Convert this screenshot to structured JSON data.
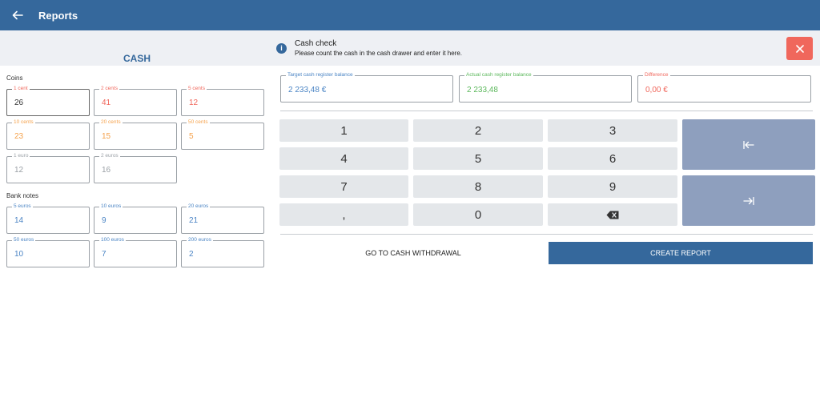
{
  "app_bar": {
    "title": "Reports",
    "back_icon": "arrow-left-icon",
    "color": "#35689c"
  },
  "cash_panel": {
    "heading": "CASH",
    "coins_label": "Coins",
    "notes_label": "Bank notes",
    "coins": [
      {
        "label": "1 cent",
        "value": "26"
      },
      {
        "label": "2 cents",
        "value": "41"
      },
      {
        "label": "5 cents",
        "value": "12"
      },
      {
        "label": "10 cents",
        "value": "23"
      },
      {
        "label": "20 cents",
        "value": "15"
      },
      {
        "label": "50 cents",
        "value": "5"
      },
      {
        "label": "1 euro",
        "value": "12"
      },
      {
        "label": "2 euros",
        "value": "16"
      }
    ],
    "notes": [
      {
        "label": "5 euros",
        "value": "14"
      },
      {
        "label": "10 euros",
        "value": "9"
      },
      {
        "label": "20 euros",
        "value": "21"
      },
      {
        "label": "50 euros",
        "value": "10"
      },
      {
        "label": "100 euros",
        "value": "7"
      },
      {
        "label": "200 euros",
        "value": "2"
      }
    ]
  },
  "info": {
    "icon": "info-icon",
    "title": "Cash check",
    "text": "Please count the cash in the cash drawer and enter it here.",
    "close_icon": "close-icon"
  },
  "balances": {
    "target": {
      "label": "Target cash register balance",
      "value": "2 233,48 €"
    },
    "actual": {
      "label": "Actual cash register balance",
      "value": "2 233,48"
    },
    "difference": {
      "label": "Difference",
      "value": "0,00 €"
    }
  },
  "keypad": {
    "keys": [
      "1",
      "2",
      "3",
      "4",
      "5",
      "6",
      "7",
      "8",
      "9",
      ",",
      "0"
    ],
    "backspace_icon": "backspace-icon",
    "prev_icon": "arrow-to-left-icon",
    "next_icon": "arrow-to-right-icon"
  },
  "actions": {
    "cash_withdrawal": "GO TO CASH WITHDRAWAL",
    "create_report": "CREATE REPORT"
  },
  "colors": {
    "primary": "#35689c",
    "danger": "#f0675c",
    "warning": "#f5a24c",
    "success": "#5cb85c",
    "keypad_side": "#8e9fbe"
  }
}
